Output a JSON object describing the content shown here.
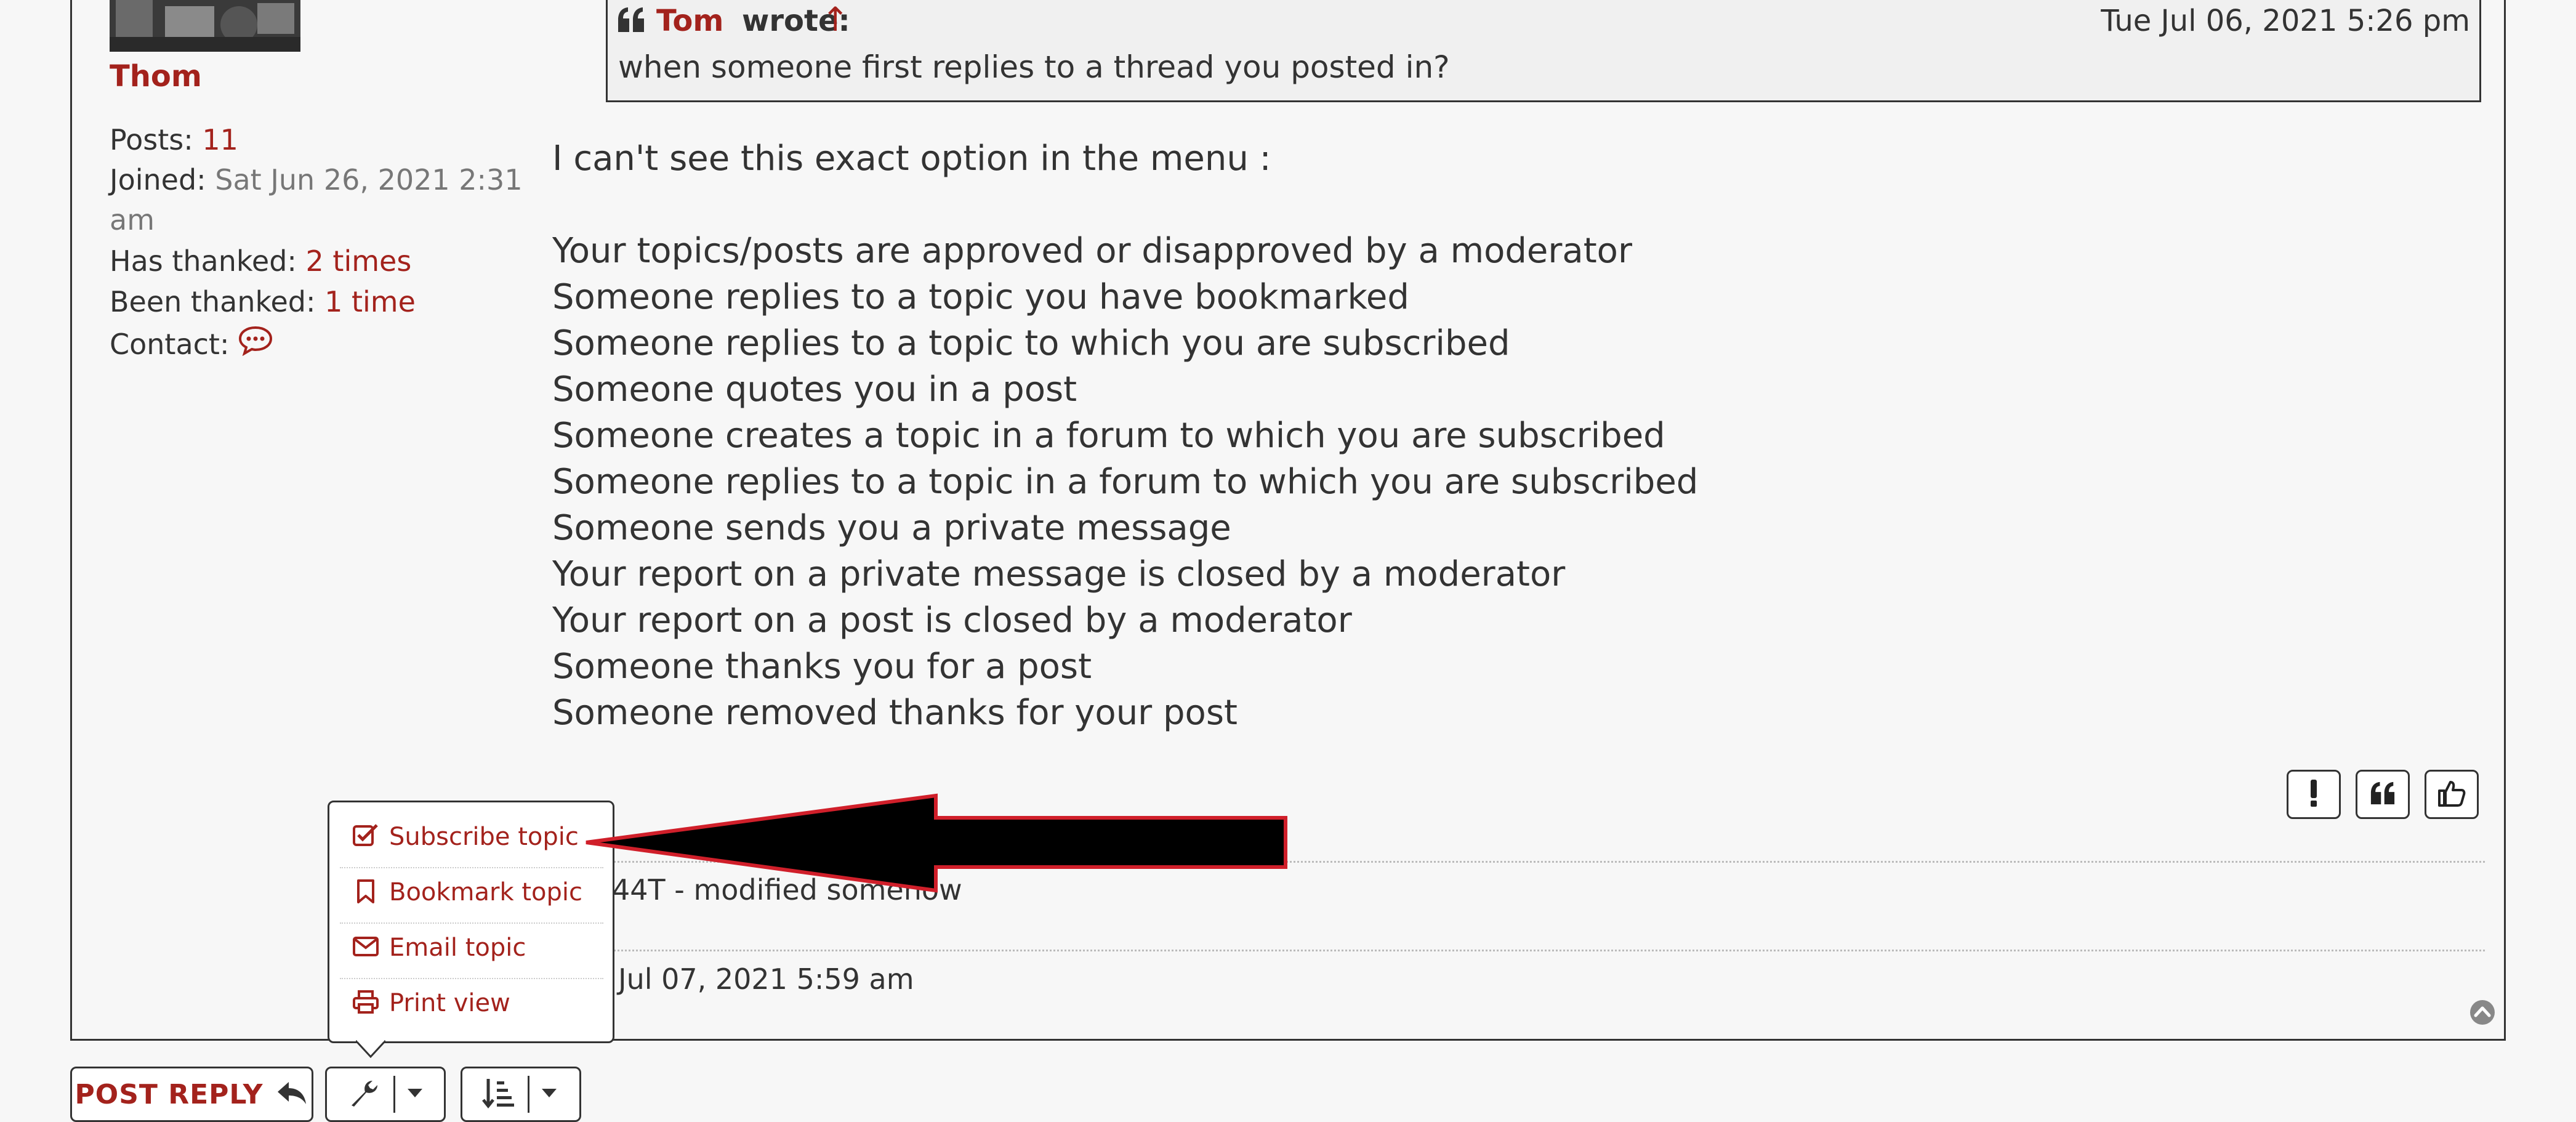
{
  "author": {
    "name": "Thom",
    "posts_label": "Posts:",
    "posts_value": "11",
    "joined_label": "Joined:",
    "joined_value_line1": "Sat Jun 26, 2021 2:31",
    "joined_value_line2": "am",
    "thanked_label": "Has thanked:",
    "thanked_value": "2 times",
    "been_thanked_label": "Been thanked:",
    "been_thanked_value": "1 time",
    "contact_label": "Contact:",
    "contact_icon": "chat-icon"
  },
  "quote": {
    "author": "Tom",
    "wrote": "wrote:",
    "arrow": "↑",
    "date": "Tue Jul 06, 2021 5:26 pm",
    "text": "when someone first replies to a thread you posted in?"
  },
  "body": {
    "intro": "I can't see this exact option in the menu :",
    "lines": [
      "Your topics/posts are approved or disapproved by a moderator",
      "Someone replies to a topic you have bookmarked",
      "Someone replies to a topic to which you are subscribed",
      "Someone quotes you in a post",
      "Someone creates a topic in a forum to which you are subscribed",
      "Someone replies to a topic in a forum to which you are subscribed",
      "Someone sends you a private message",
      "Your report on a private message is closed by a moderator",
      "Your report on a post is closed by a moderator",
      "Someone thanks you for a post",
      "Someone removed thanks for your post"
    ]
  },
  "post_actions": {
    "report_icon": "exclamation-icon",
    "quote_icon": "quote-icon",
    "thanks_icon": "thumbs-up-icon"
  },
  "signature": "44T - modified somehow",
  "edit_info": "Jul 07, 2021 5:59 am",
  "dropdown": {
    "items": [
      {
        "label": "Subscribe topic",
        "icon": "check-square-icon"
      },
      {
        "label": "Bookmark topic",
        "icon": "bookmark-icon"
      },
      {
        "label": "Email topic",
        "icon": "envelope-icon"
      },
      {
        "label": "Print view",
        "icon": "printer-icon"
      }
    ]
  },
  "toolbar": {
    "post_reply": "POST REPLY",
    "reply_icon": "reply-arrow-icon",
    "tools_icon": "wrench-icon",
    "sort_icon": "sort-icon"
  },
  "colors": {
    "accent": "#a3221c",
    "text": "#333333",
    "background": "#f7f7f7",
    "annotation_arrow": "#000000",
    "annotation_outline": "#d01f2a"
  }
}
